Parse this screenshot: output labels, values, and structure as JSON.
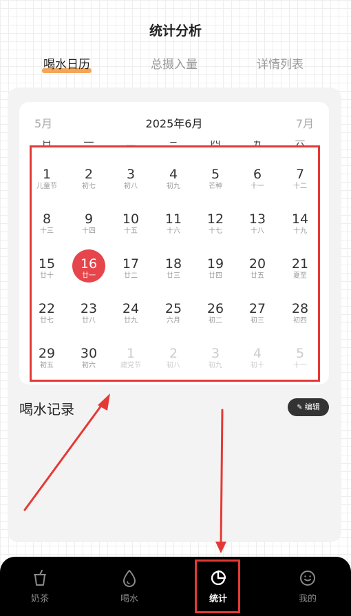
{
  "header": {
    "title": "统计分析"
  },
  "tabs": [
    {
      "label": "喝水日历",
      "active": true
    },
    {
      "label": "总摄入量",
      "active": false
    },
    {
      "label": "详情列表",
      "active": false
    }
  ],
  "calendar": {
    "prev_month": "5月",
    "current_month": "2025年6月",
    "next_month": "7月",
    "weekdays": [
      "日",
      "一",
      "二",
      "三",
      "四",
      "五",
      "六"
    ],
    "days": [
      {
        "num": "1",
        "lunar": "儿童节"
      },
      {
        "num": "2",
        "lunar": "初七"
      },
      {
        "num": "3",
        "lunar": "初八"
      },
      {
        "num": "4",
        "lunar": "初九"
      },
      {
        "num": "5",
        "lunar": "芒种"
      },
      {
        "num": "6",
        "lunar": "十一"
      },
      {
        "num": "7",
        "lunar": "十二"
      },
      {
        "num": "8",
        "lunar": "十三"
      },
      {
        "num": "9",
        "lunar": "十四"
      },
      {
        "num": "10",
        "lunar": "十五"
      },
      {
        "num": "11",
        "lunar": "十六"
      },
      {
        "num": "12",
        "lunar": "十七"
      },
      {
        "num": "13",
        "lunar": "十八"
      },
      {
        "num": "14",
        "lunar": "十九"
      },
      {
        "num": "15",
        "lunar": "廿十"
      },
      {
        "num": "16",
        "lunar": "廿一",
        "selected": true
      },
      {
        "num": "17",
        "lunar": "廿二"
      },
      {
        "num": "18",
        "lunar": "廿三"
      },
      {
        "num": "19",
        "lunar": "廿四"
      },
      {
        "num": "20",
        "lunar": "廿五"
      },
      {
        "num": "21",
        "lunar": "夏至"
      },
      {
        "num": "22",
        "lunar": "廿七"
      },
      {
        "num": "23",
        "lunar": "廿八"
      },
      {
        "num": "24",
        "lunar": "廿九"
      },
      {
        "num": "25",
        "lunar": "六月"
      },
      {
        "num": "26",
        "lunar": "初二"
      },
      {
        "num": "27",
        "lunar": "初三"
      },
      {
        "num": "28",
        "lunar": "初四"
      },
      {
        "num": "29",
        "lunar": "初五"
      },
      {
        "num": "30",
        "lunar": "初六"
      },
      {
        "num": "1",
        "lunar": "建党节",
        "muted": true
      },
      {
        "num": "2",
        "lunar": "初八",
        "muted": true
      },
      {
        "num": "3",
        "lunar": "初九",
        "muted": true
      },
      {
        "num": "4",
        "lunar": "初十",
        "muted": true
      },
      {
        "num": "5",
        "lunar": "十一",
        "muted": true
      }
    ]
  },
  "records": {
    "title": "喝水记录",
    "edit_label": "编辑"
  },
  "bottom_nav": [
    {
      "label": "奶茶",
      "icon": "cup-icon",
      "active": false
    },
    {
      "label": "喝水",
      "icon": "water-drop-icon",
      "active": false
    },
    {
      "label": "统计",
      "icon": "pie-chart-icon",
      "active": true
    },
    {
      "label": "我的",
      "icon": "smiley-icon",
      "active": false
    }
  ],
  "colors": {
    "accent": "#e5454b",
    "tab_underline": "#f2a65a",
    "annotation_red": "#e53935",
    "tabbar_bg": "#000000"
  }
}
